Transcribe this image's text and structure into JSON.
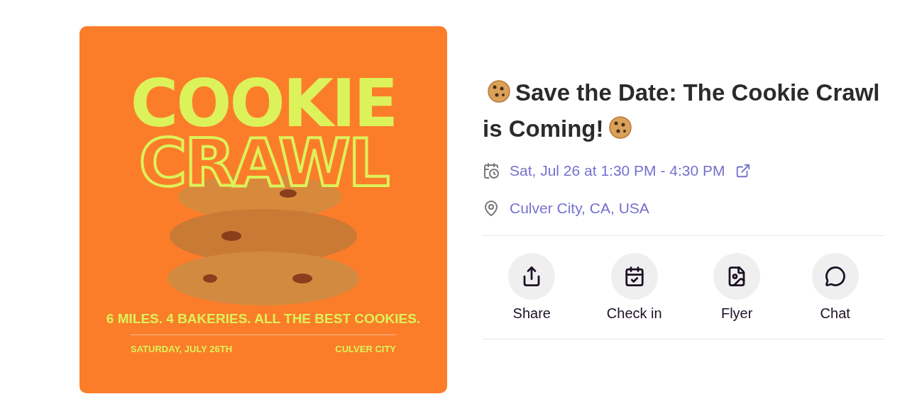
{
  "flyer": {
    "title_top": "COOKIE",
    "title_bottom": "CRAWL",
    "tagline": "6 MILES. 4 BAKERIES. ALL THE BEST COOKIES.",
    "date": "SATURDAY, JULY 26TH",
    "place": "CULVER CITY"
  },
  "event": {
    "title": "Save the Date: The Cookie Crawl is Coming!",
    "when": "Sat, Jul 26 at 1:30 PM - 4:30 PM",
    "where": "Culver City, CA, USA"
  },
  "actions": [
    {
      "kind": "share",
      "label": "Share"
    },
    {
      "kind": "checkin",
      "label": "Check in"
    },
    {
      "kind": "flyer",
      "label": "Flyer"
    },
    {
      "kind": "chat",
      "label": "Chat"
    }
  ]
}
